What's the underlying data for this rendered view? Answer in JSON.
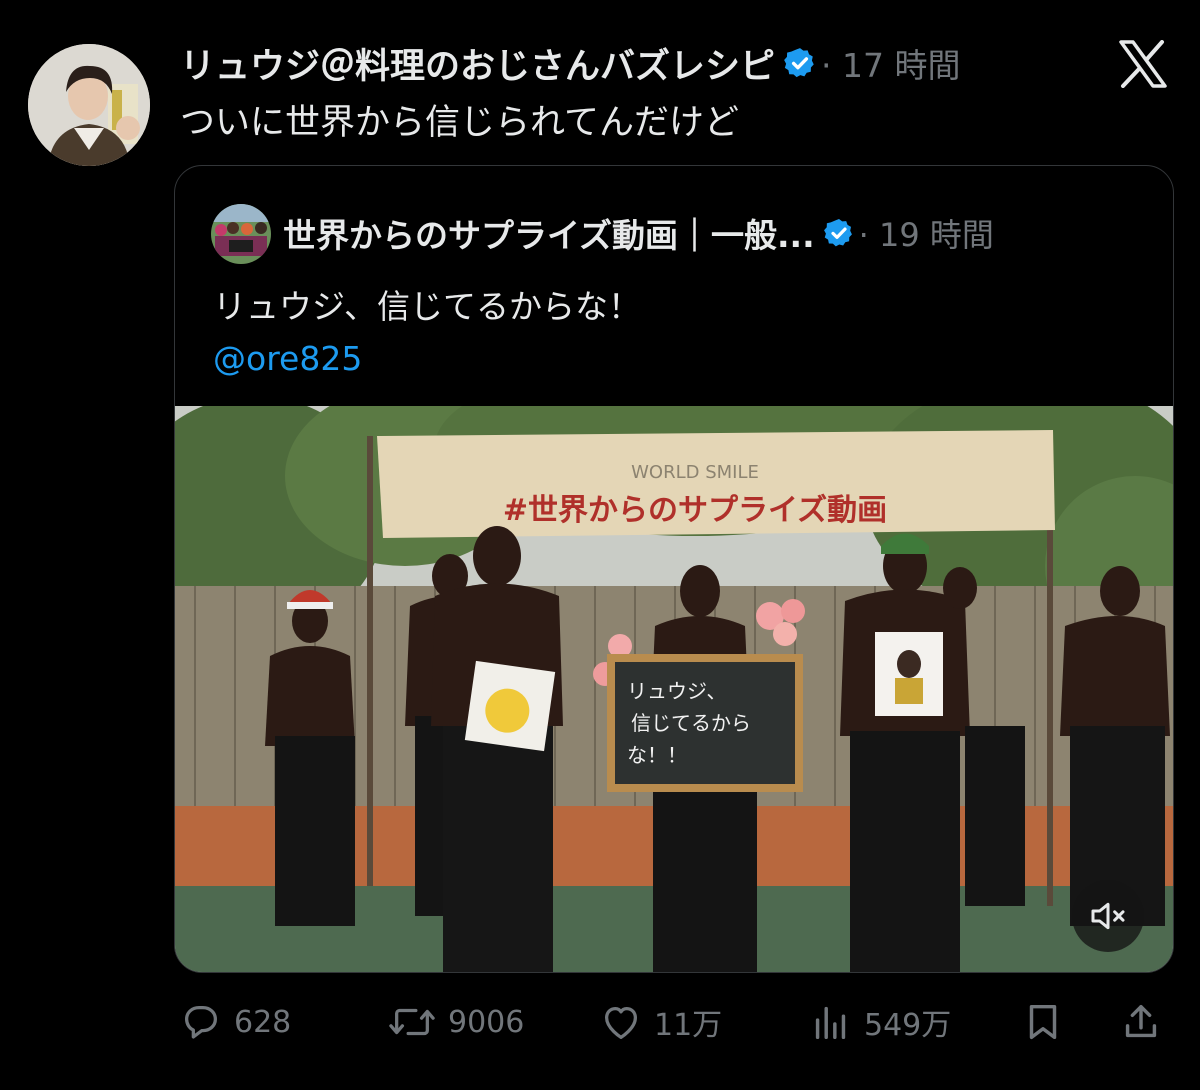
{
  "tweet": {
    "author_name": "リュウジ＠料理のおじさんバズレシピ",
    "separator_time": "· 17 時間",
    "text": "ついに世界から信じられてんだけど"
  },
  "quote": {
    "author_name": "世界からのサプライズ動画｜一般...",
    "separator_time": "· 19 時間",
    "text": "リュウジ、信じてるからな！",
    "mention": "@ore825",
    "media": {
      "banner_small": "WORLD SMILE",
      "banner_main": "#世界からのサプライズ動画",
      "board_lines": [
        "リュウジ、",
        "信じてるから",
        "な！！"
      ]
    }
  },
  "actions": {
    "replies": "628",
    "reposts": "9006",
    "likes": "11万",
    "views": "549万"
  },
  "colors": {
    "background": "#000000",
    "text_primary": "#e7e9ea",
    "text_secondary": "#71767b",
    "link": "#1d9bf0",
    "verified": "#1d9bf0"
  },
  "icons": {
    "verified": "verified-badge-icon",
    "platform": "x-logo-icon",
    "reply": "speech-bubble-icon",
    "repost": "repost-arrows-icon",
    "like": "heart-icon",
    "views": "bar-chart-icon",
    "bookmark": "bookmark-icon",
    "share": "share-upload-icon",
    "mute": "speaker-muted-icon"
  }
}
